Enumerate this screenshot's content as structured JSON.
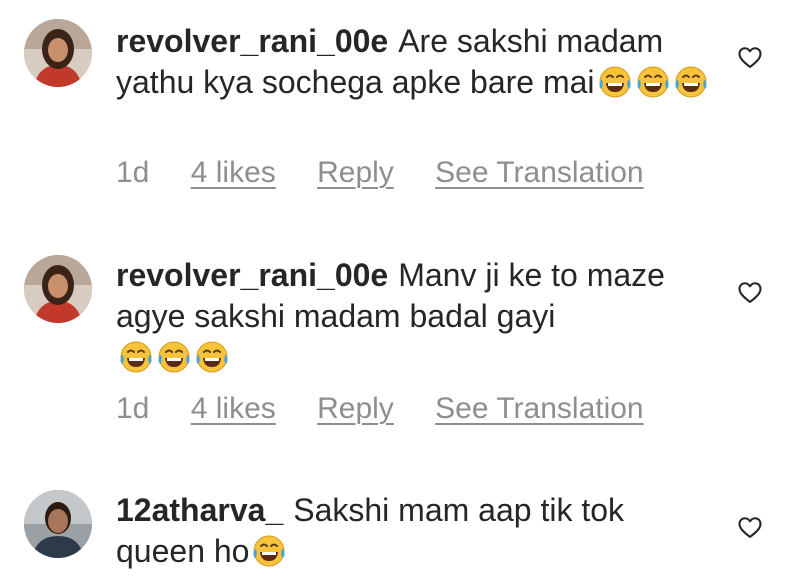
{
  "comments": [
    {
      "username": "revolver_rani_00e",
      "text": "Are sakshi madam yathu kya sochega apke bare mai",
      "emoji": "face-with-tears-of-joy x3",
      "time": "1d",
      "likes": "4 likes",
      "reply": "Reply",
      "translate": "See Translation"
    },
    {
      "username": "revolver_rani_00e",
      "text": "Manv ji ke to maze agye sakshi madam badal gayi",
      "emoji": "face-with-tears-of-joy x3",
      "time": "1d",
      "likes": "4 likes",
      "reply": "Reply",
      "translate": "See Translation"
    },
    {
      "username": "12atharva_",
      "text": "Sakshi mam aap tik tok queen ho",
      "emoji": "face-with-tears-of-joy x1"
    }
  ],
  "icons": {
    "like": "heart-outline-icon",
    "emoji": "face-with-tears-of-joy"
  },
  "colors": {
    "text": "#262626",
    "meta": "#8e8e8e",
    "emoji_face": "#f6c33a",
    "emoji_tear": "#4aa3df"
  }
}
